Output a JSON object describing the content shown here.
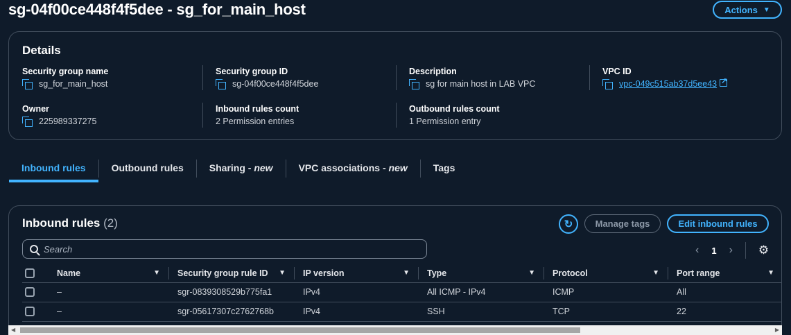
{
  "header": {
    "title": "sg-04f00ce448f4f5dee - sg_for_main_host",
    "actions_label": "Actions"
  },
  "details": {
    "heading": "Details",
    "fields": [
      {
        "label": "Security group name",
        "value": "sg_for_main_host"
      },
      {
        "label": "Security group ID",
        "value": "sg-04f00ce448f4f5dee"
      },
      {
        "label": "Description",
        "value": "sg for main host in LAB VPC"
      },
      {
        "label": "VPC ID",
        "value": "vpc-049c515ab37d5ee43"
      },
      {
        "label": "Owner",
        "value": "225989337275"
      },
      {
        "label": "Inbound rules count",
        "value": "2 Permission entries"
      },
      {
        "label": "Outbound rules count",
        "value": "1 Permission entry"
      }
    ]
  },
  "tabs": [
    {
      "label": "Inbound rules",
      "suffix": ""
    },
    {
      "label": "Outbound rules",
      "suffix": ""
    },
    {
      "label": "Sharing - ",
      "suffix": "new"
    },
    {
      "label": "VPC associations - ",
      "suffix": "new"
    },
    {
      "label": "Tags",
      "suffix": ""
    }
  ],
  "inbound": {
    "heading": "Inbound rules",
    "count": "(2)",
    "manage_tags_label": "Manage tags",
    "edit_label": "Edit inbound rules",
    "search_placeholder": "Search",
    "page": "1",
    "columns": [
      "Name",
      "Security group rule ID",
      "IP version",
      "Type",
      "Protocol",
      "Port range"
    ],
    "rows": [
      [
        "–",
        "sgr-0839308529b775fa1",
        "IPv4",
        "All ICMP - IPv4",
        "ICMP",
        "All"
      ],
      [
        "–",
        "sgr-05617307c2762768b",
        "IPv4",
        "SSH",
        "TCP",
        "22"
      ]
    ]
  },
  "colors": {
    "background": "#0f1b2a",
    "accent": "#42b4ff",
    "border": "#414d5c"
  }
}
